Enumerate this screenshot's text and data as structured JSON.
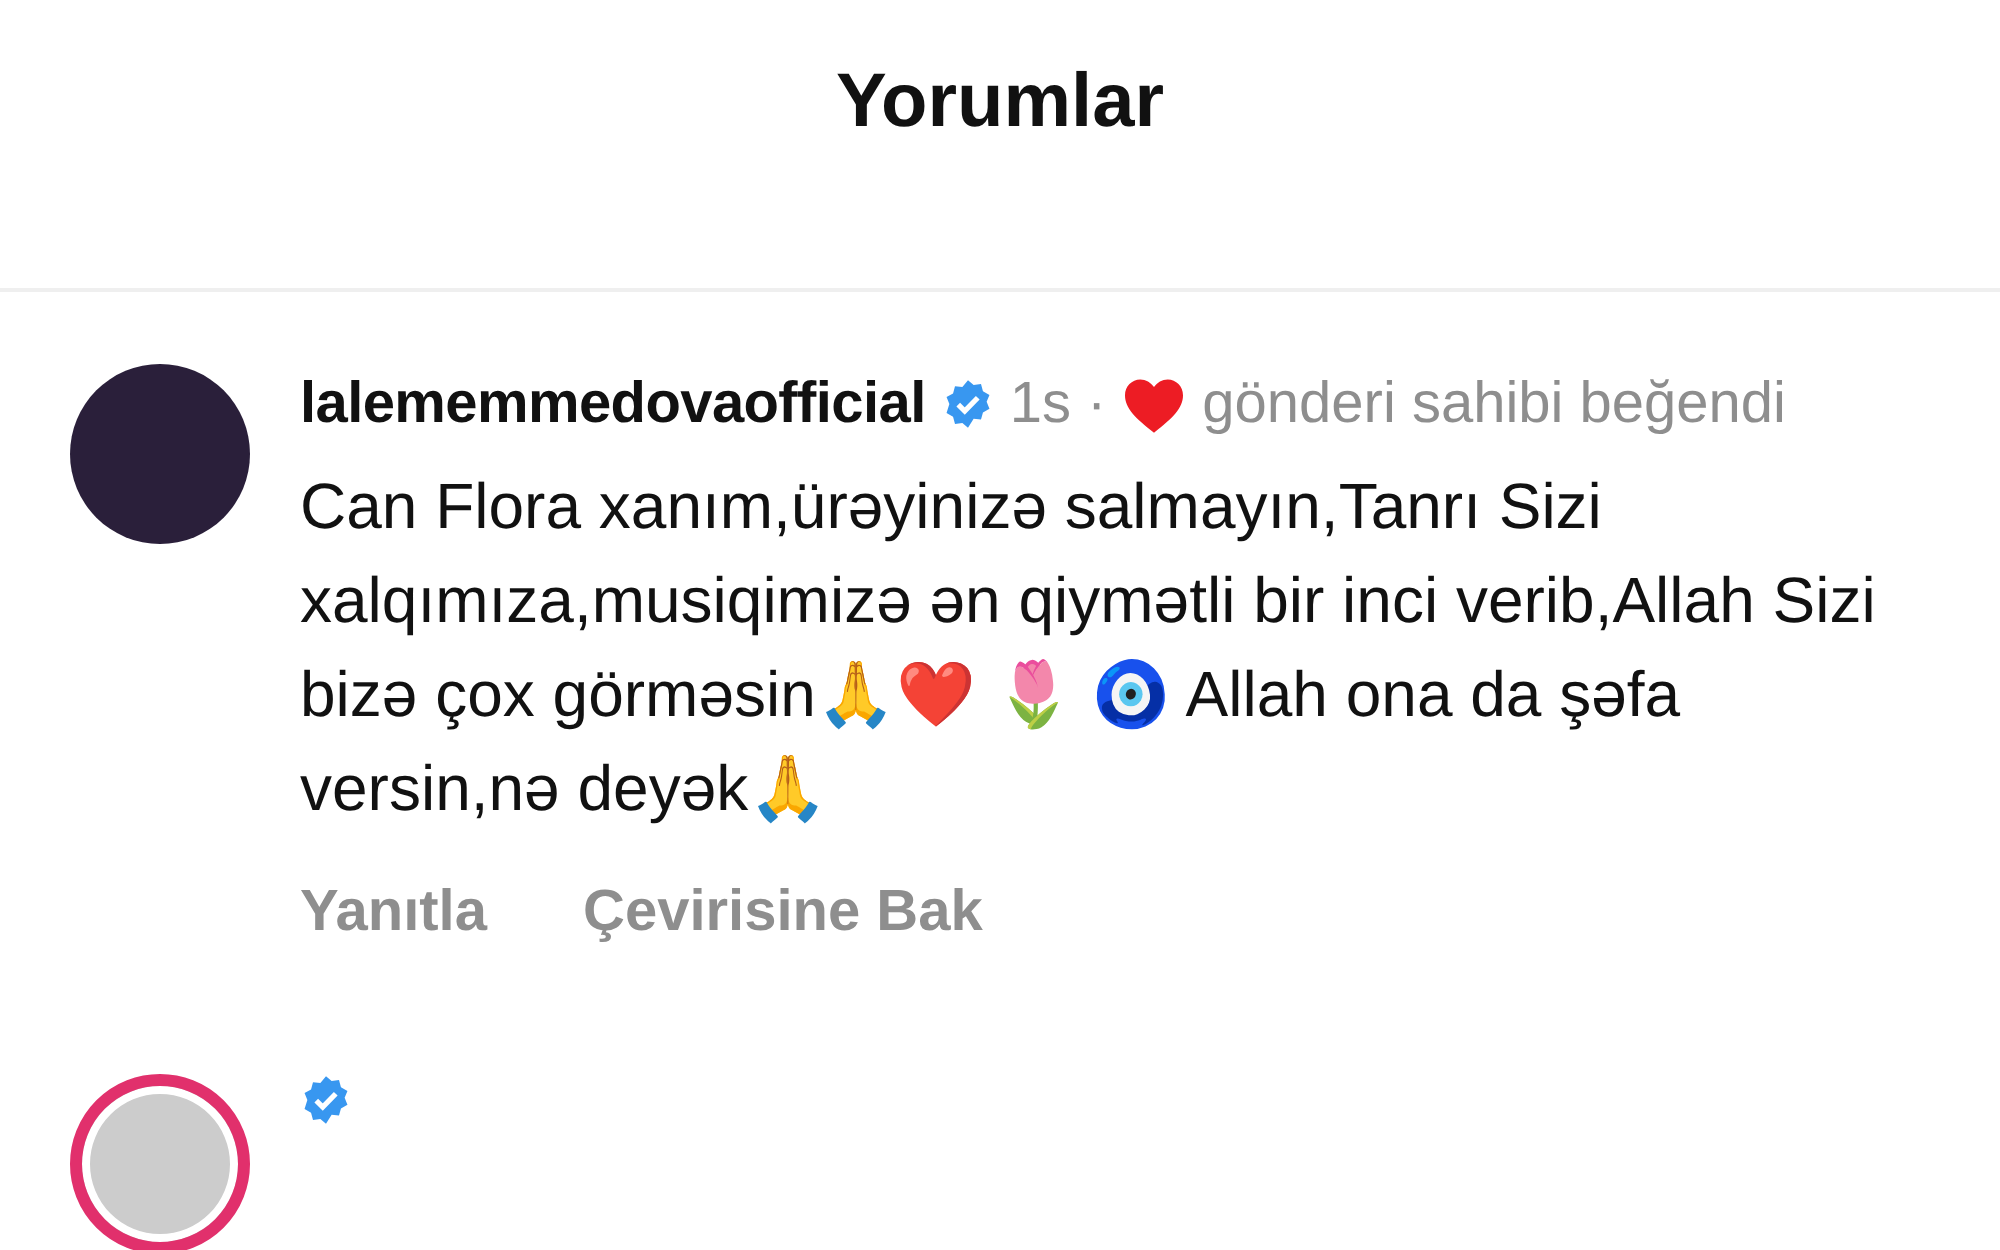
{
  "header": {
    "title": "Yorumlar"
  },
  "comments": [
    {
      "username": "lalememmedovaofficial",
      "verified": true,
      "time": "1s",
      "separator": "·",
      "liked_by_author": true,
      "liked_label": "gönderi sahibi beğendi",
      "text": "Can Flora xanım,ürəyinizə salmayın,Tanrı Sizi xalqımıza,musiqimizə ən qiymətli bir inci verib,Allah Sizi bizə çox görməsin🙏❤️ 🌷 🧿 Allah ona da şəfa versin,nə deyək🙏",
      "actions": [
        "Yanıtla",
        "Çevirisine Bak"
      ],
      "has_story": false
    },
    {
      "verified": true,
      "has_story": true
    }
  ]
}
